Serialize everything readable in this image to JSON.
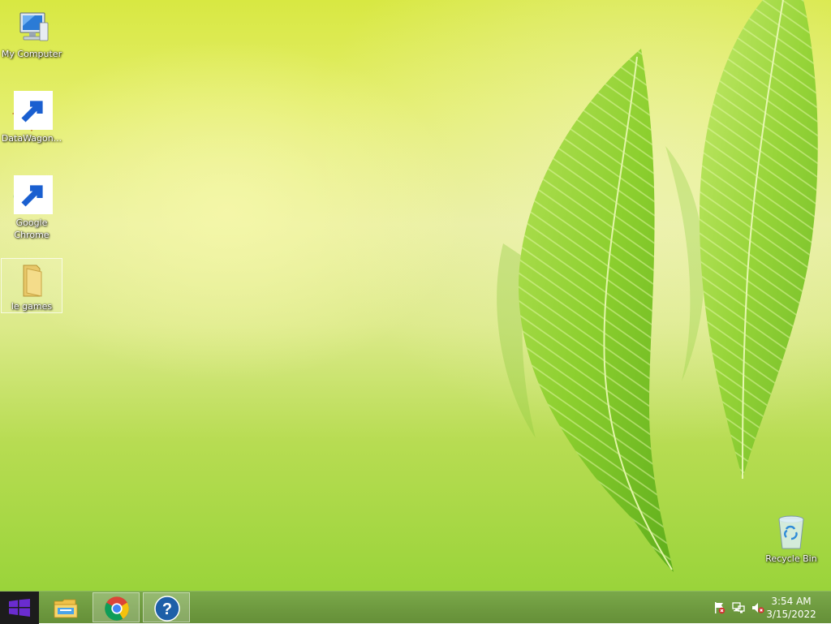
{
  "desktop": {
    "icons": [
      {
        "label": "My Computer",
        "icon": "computer-icon"
      },
      {
        "label": "DataWagon...",
        "icon": "datawagon-icon",
        "shortcut": true
      },
      {
        "label": "Google Chrome",
        "icon": "chrome-icon",
        "shortcut": true
      },
      {
        "label": "le games",
        "icon": "folder-icon",
        "selected": true
      },
      {
        "label": "Recycle Bin",
        "icon": "recycle-bin-icon"
      }
    ]
  },
  "taskbar": {
    "start": {
      "icon": "windows-logo-icon"
    },
    "pinned": [
      {
        "icon": "file-explorer-icon",
        "active": false
      },
      {
        "icon": "chrome-icon",
        "active": true
      },
      {
        "icon": "help-icon",
        "active": true
      }
    ],
    "tray": {
      "icons": [
        "action-center-flag-icon",
        "network-icon",
        "volume-muted-icon"
      ],
      "time": "3:54 AM",
      "date": "3/15/2022"
    }
  },
  "colors": {
    "taskbar": "#6f9b40",
    "start_button": "#1c1c1c",
    "windows_logo": "#6a2ccf",
    "wallpaper_top": "#d8e842",
    "wallpaper_bottom": "#9ad43a"
  }
}
